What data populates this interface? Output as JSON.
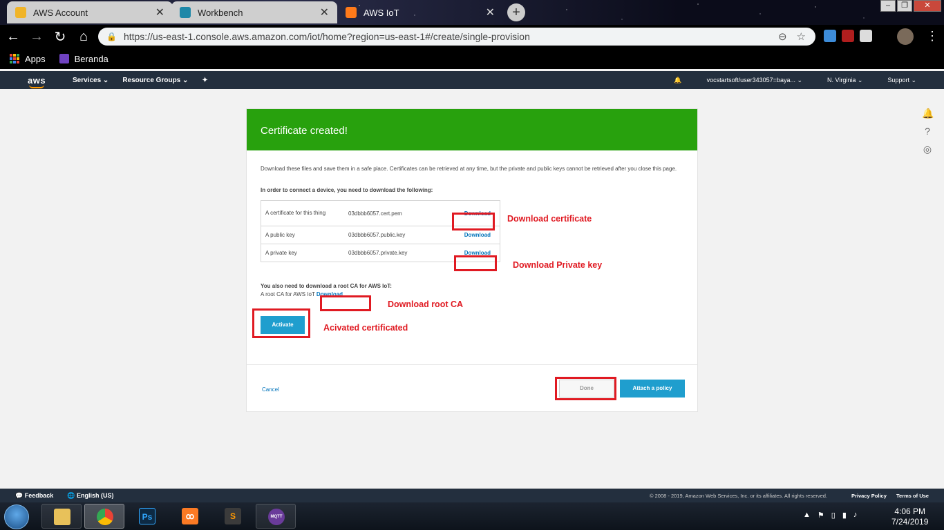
{
  "browser": {
    "tabs": [
      {
        "label": "AWS Account",
        "favicon_color": "#f0b429",
        "active": false
      },
      {
        "label": "Workbench",
        "favicon_color": "#1e88a8",
        "active": false
      },
      {
        "label": "AWS IoT",
        "favicon_color": "#ff7a1a",
        "active": true
      }
    ],
    "url": "https://us-east-1.console.aws.amazon.com/iot/home?region=us-east-1#/create/single-provision",
    "bookmarks": [
      {
        "label": "Apps",
        "icon": "apps-grid-icon"
      },
      {
        "label": "Beranda",
        "icon": "beranda-icon"
      }
    ]
  },
  "aws_header": {
    "logo": "aws",
    "services": "Services",
    "resource_groups": "Resource Groups",
    "account": "vocstartsoft/user343057=baya...",
    "region": "N. Virginia",
    "support": "Support"
  },
  "dialog": {
    "title": "Certificate created!",
    "intro": "Download these files and save them in a safe place. Certificates can be retrieved at any time, but the private and public keys cannot be retrieved after you close this page.",
    "subtitle": "In order to connect a device, you need to download the following:",
    "files": [
      {
        "label": "A certificate for this thing",
        "file": "03dbbb6057.cert.pem",
        "action": "Download"
      },
      {
        "label": "A public key",
        "file": "03dbbb6057.public.key",
        "action": "Download"
      },
      {
        "label": "A private key",
        "file": "03dbbb6057.private.key",
        "action": "Download"
      }
    ],
    "root_ca_heading": "You also need to download a root CA for AWS IoT:",
    "root_ca_label": "A root CA for AWS IoT",
    "root_ca_action": "Download",
    "activate": "Activate",
    "cancel": "Cancel",
    "done": "Done",
    "attach_policy": "Attach a policy"
  },
  "annotations": {
    "download_certificate": "Download certificate",
    "download_private_key": "Download Private key",
    "download_root_ca": "Download root CA",
    "activated": "Acivated certificated",
    "color": "#e01a22"
  },
  "aws_footer": {
    "feedback": "Feedback",
    "language": "English (US)",
    "copyright": "© 2008 - 2019, Amazon Web Services, Inc. or its affiliates. All rights reserved.",
    "privacy": "Privacy Policy",
    "terms": "Terms of Use"
  },
  "taskbar": {
    "time": "4:06 PM",
    "date": "7/24/2019",
    "apps": [
      {
        "name": "file-explorer",
        "glyph": ""
      },
      {
        "name": "chrome",
        "glyph": ""
      },
      {
        "name": "photoshop",
        "glyph": "Ps"
      },
      {
        "name": "xampp",
        "glyph": "ꝏ"
      },
      {
        "name": "sublime-text",
        "glyph": "S"
      },
      {
        "name": "mqtt-fx",
        "glyph": "MQTT"
      }
    ]
  }
}
